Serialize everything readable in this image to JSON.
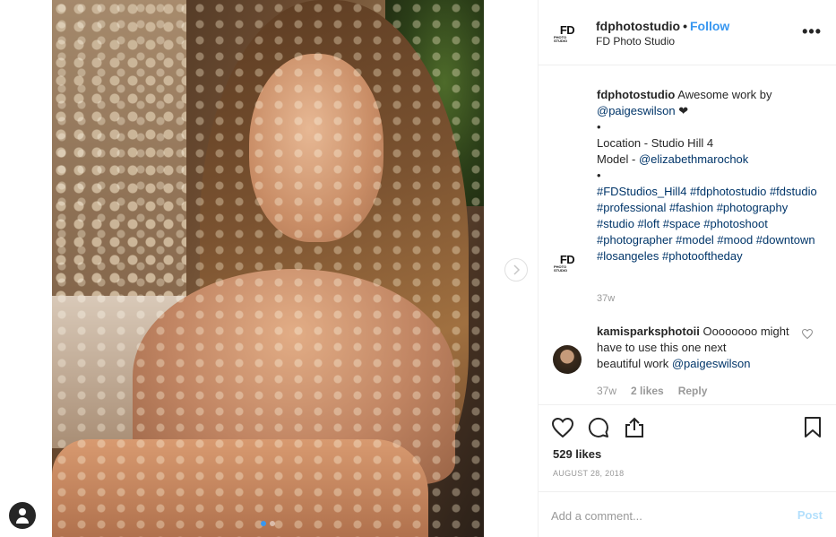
{
  "post": {
    "slide_count": 2,
    "active_slide": 1
  },
  "header": {
    "logo_text": "FD",
    "logo_subtext": "PHOTO STUDIO",
    "username": "fdphotostudio",
    "bullet": "•",
    "follow_label": "Follow",
    "fullname": "FD Photo Studio",
    "more_label": "•••"
  },
  "caption": {
    "username": "fdphotostudio",
    "text_1": "Awesome work by",
    "mention_1": "@paigeswilson",
    "emoji": "❤",
    "bullet": "•",
    "location_line": "Location - Studio Hill 4",
    "model_prefix": "Model - ",
    "model_mention": "@elizabethmarochok",
    "hashtags": "#FDStudios_Hill4 #fdphotostudio #fdstudio #professional #fashion #photography #studio #loft #space #photoshoot #photographer #model #mood #downtown #losangeles #photooftheday",
    "time": "37w"
  },
  "comment": {
    "username": "kamisparksphotoii",
    "text": "Oooooooo might have to use this one next",
    "text_2": "beautiful work",
    "mention": "@paigeswilson",
    "time": "37w",
    "likes": "2 likes",
    "reply_label": "Reply"
  },
  "actions": {
    "like_count": "529 likes",
    "date": "AUGUST 28, 2018"
  },
  "add_comment": {
    "placeholder": "Add a comment...",
    "post_label": "Post"
  },
  "colors": {
    "accent": "#3897f0",
    "link": "#003569",
    "muted": "#999999",
    "post_disabled": "#b2dffc"
  },
  "icons": [
    "heart-icon",
    "comment-icon",
    "share-icon",
    "bookmark-icon",
    "more-icon",
    "chevron-right-icon",
    "user-icon"
  ]
}
